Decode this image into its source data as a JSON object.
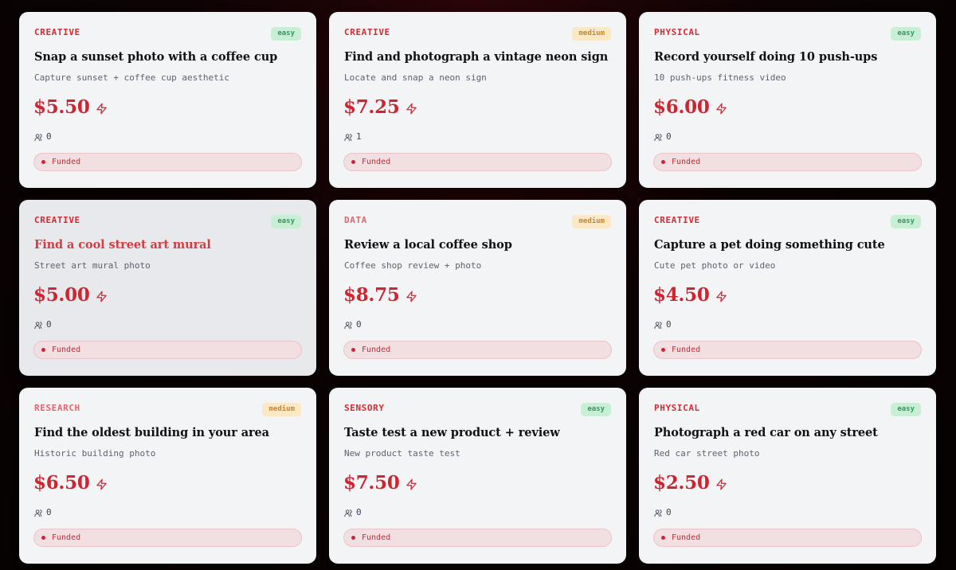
{
  "colors": {
    "accent": "#cf2530",
    "card_background": "#f3f4f6",
    "easy_badge_bg": "#c8efd6",
    "easy_badge_text": "#2e9a5a",
    "medium_badge_bg": "#fbe9c6",
    "medium_badge_text": "#c7862c"
  },
  "icons": {
    "price": "bolt-icon",
    "participants": "users-icon",
    "status": "dot"
  },
  "tasks": [
    {
      "category": "CREATIVE",
      "difficulty": "easy",
      "title": "Snap a sunset photo with a coffee cup",
      "description": "Capture sunset + coffee cup aesthetic",
      "price": "$5.50",
      "participants": "0",
      "status": "Funded"
    },
    {
      "category": "CREATIVE",
      "difficulty": "medium",
      "title": "Find and photograph a vintage neon sign",
      "description": "Locate and snap a neon sign",
      "price": "$7.25",
      "participants": "1",
      "status": "Funded"
    },
    {
      "category": "PHYSICAL",
      "difficulty": "easy",
      "title": "Record yourself doing 10 push-ups",
      "description": "10 push-ups fitness video",
      "price": "$6.00",
      "participants": "0",
      "status": "Funded"
    },
    {
      "category": "CREATIVE",
      "difficulty": "easy",
      "title": "Find a cool street art mural",
      "description": "Street art mural photo",
      "price": "$5.00",
      "participants": "0",
      "status": "Funded"
    },
    {
      "category": "DATA",
      "difficulty": "medium",
      "title": "Review a local coffee shop",
      "description": "Coffee shop review + photo",
      "price": "$8.75",
      "participants": "0",
      "status": "Funded"
    },
    {
      "category": "CREATIVE",
      "difficulty": "easy",
      "title": "Capture a pet doing something cute",
      "description": "Cute pet photo or video",
      "price": "$4.50",
      "participants": "0",
      "status": "Funded"
    },
    {
      "category": "RESEARCH",
      "difficulty": "medium",
      "title": "Find the oldest building in your area",
      "description": "Historic building photo",
      "price": "$6.50",
      "participants": "0",
      "status": "Funded"
    },
    {
      "category": "SENSORY",
      "difficulty": "easy",
      "title": "Taste test a new product + review",
      "description": "New product taste test",
      "price": "$7.50",
      "participants": "0",
      "status": "Funded"
    },
    {
      "category": "PHYSICAL",
      "difficulty": "easy",
      "title": "Photograph a red car on any street",
      "description": "Red car street photo",
      "price": "$2.50",
      "participants": "0",
      "status": "Funded"
    }
  ]
}
